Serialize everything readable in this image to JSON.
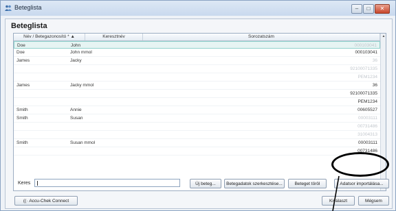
{
  "window": {
    "title": "Beteglista"
  },
  "heading": "Beteglista",
  "table": {
    "columns": [
      "Név / Betegazonosító *",
      "Keresztnév",
      "Sorozatszám"
    ],
    "rows": [
      {
        "name": "Doe",
        "first": "John",
        "serial": "000103041",
        "muted": true,
        "selected": true
      },
      {
        "name": "Doe",
        "first": "John mmol",
        "serial": "000103041",
        "muted": false
      },
      {
        "name": "James",
        "first": "Jacky",
        "serial": "36",
        "muted": true
      },
      {
        "name": "",
        "first": "",
        "serial": "92100071335",
        "muted": true
      },
      {
        "name": "",
        "first": "",
        "serial": "PEM1234",
        "muted": true
      },
      {
        "name": "James",
        "first": "Jacky mmol",
        "serial": "36",
        "muted": false
      },
      {
        "name": "",
        "first": "",
        "serial": "92100071335",
        "muted": false
      },
      {
        "name": "",
        "first": "",
        "serial": "PEM1234",
        "muted": false
      },
      {
        "name": "Smith",
        "first": "Annie",
        "serial": "00605527",
        "muted": false
      },
      {
        "name": "Smith",
        "first": "Susan",
        "serial": "00003111",
        "muted": true
      },
      {
        "name": "",
        "first": "",
        "serial": "00731486",
        "muted": true
      },
      {
        "name": "",
        "first": "",
        "serial": "31004313",
        "muted": true
      },
      {
        "name": "Smith",
        "first": "Susan mmol",
        "serial": "00003111",
        "muted": false
      },
      {
        "name": "",
        "first": "",
        "serial": "00731486",
        "muted": false
      }
    ]
  },
  "search": {
    "label": "Keres",
    "value": ""
  },
  "buttons": {
    "new_patient": "Új beteg...",
    "edit_patient": "Betegadatok szerkesztése...",
    "delete_patient": "Beteget töröl",
    "import_data": "Adatsor importálása...",
    "connect": "Accu-Chek Connect",
    "select": "Kiválaszt",
    "cancel": "Mégsem"
  },
  "colors": {
    "selected_row": "#e6f4f3",
    "highlight_circle": "#000000",
    "close_button": "#c8452a"
  }
}
